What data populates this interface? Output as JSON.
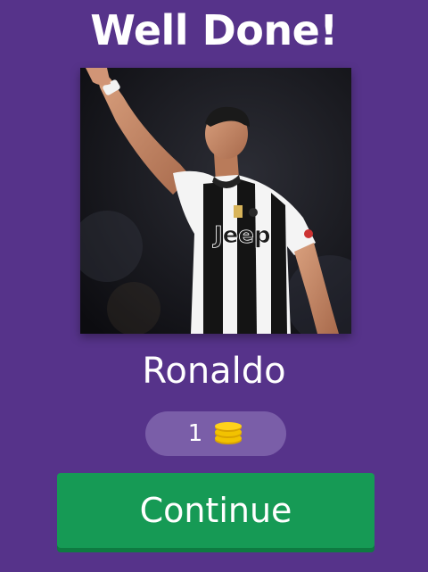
{
  "header": {
    "title": "Well Done!"
  },
  "photo": {
    "subject": "footballer in black and white striped jersey raising right arm",
    "jersey_text": "Jeep"
  },
  "answer": {
    "name": "Ronaldo"
  },
  "reward": {
    "count": "1",
    "icon": "coin-stack-icon"
  },
  "actions": {
    "continue_label": "Continue"
  },
  "colors": {
    "background": "#56338a",
    "pill": "#7a5ea8",
    "button": "#169a55",
    "coin": "#f2c200"
  }
}
